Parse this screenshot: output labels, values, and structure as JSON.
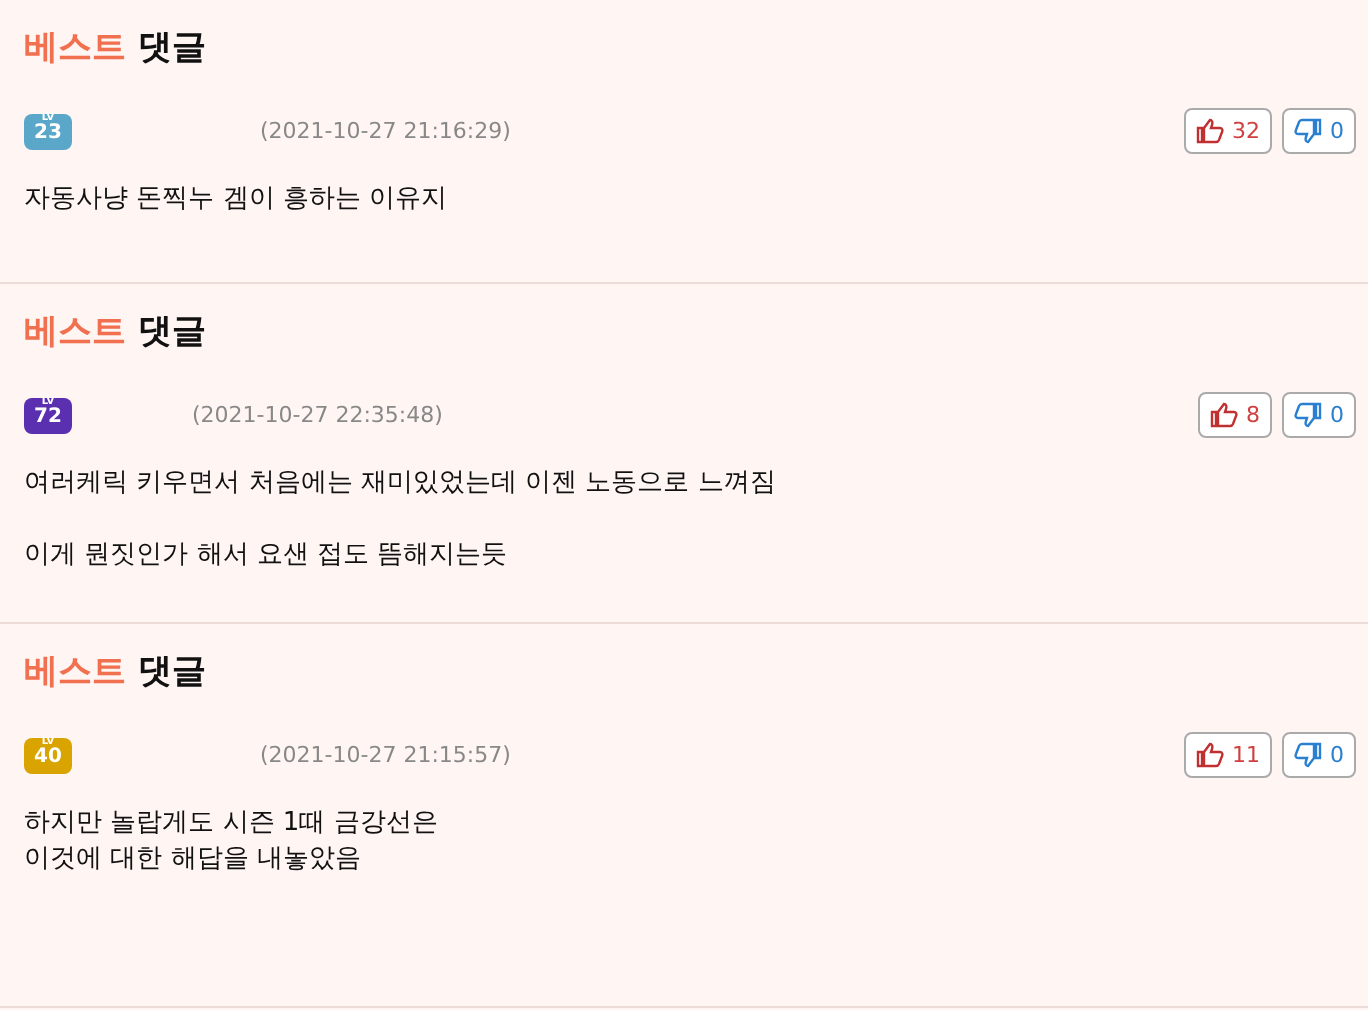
{
  "comments": [
    {
      "heading_accent": "베스트",
      "heading": "댓글",
      "level_badge": {
        "prefix": "LV",
        "number": "23",
        "color": "#5aa7c9"
      },
      "date": "(2021-10-27 21:16:29)",
      "likes": "32",
      "dislikes": "0",
      "paragraphs": [
        [
          "자동사냥 돈찍누 겜이 흥하는 이유지"
        ]
      ]
    },
    {
      "heading_accent": "베스트",
      "heading": "댓글",
      "level_badge": {
        "prefix": "LV",
        "number": "72",
        "color": "#5a2fb0"
      },
      "date": "(2021-10-27 22:35:48)",
      "likes": "8",
      "dislikes": "0",
      "paragraphs": [
        [
          "여러케릭 키우면서 처음에는 재미있었는데 이젠 노동으로 느껴짐"
        ],
        [
          "이게 뭔짓인가 해서 요샌 접도 뜸해지는듯"
        ]
      ]
    },
    {
      "heading_accent": "베스트",
      "heading": "댓글",
      "level_badge": {
        "prefix": "LV",
        "number": "40",
        "color": "#d9a400"
      },
      "date": "(2021-10-27 21:15:57)",
      "likes": "11",
      "dislikes": "0",
      "paragraphs": [
        [
          "하지만 놀랍게도 시즌 1때 금강선은",
          "이것에 대한 해답을 내놓았음"
        ]
      ]
    }
  ]
}
